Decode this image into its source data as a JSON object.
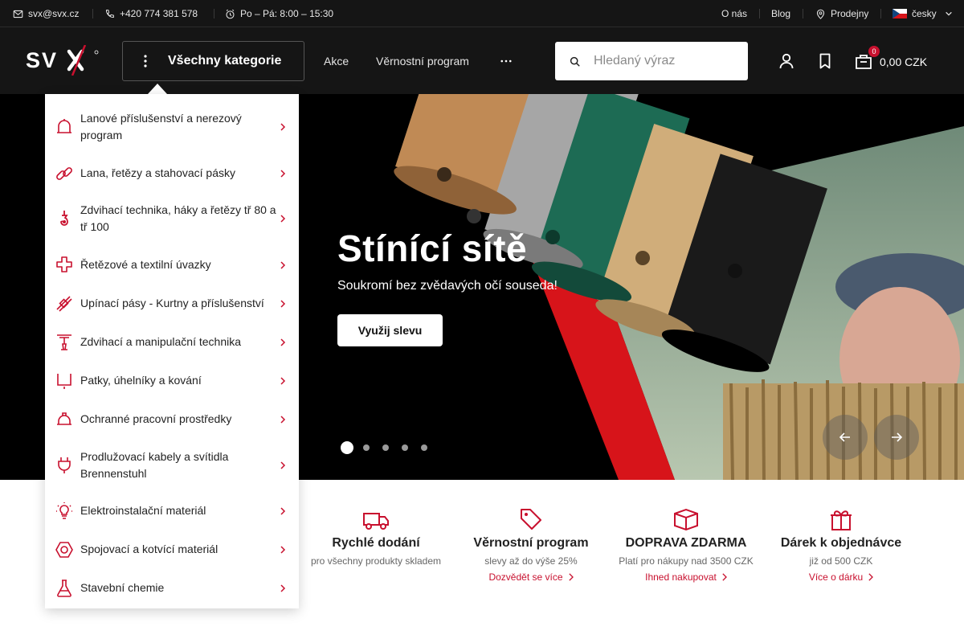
{
  "topbar": {
    "email": "svx@svx.cz",
    "phone": "+420 774 381 578",
    "hours": "Po – Pá: 8:00 – 15:30",
    "about": "O nás",
    "blog": "Blog",
    "stores": "Prodejny",
    "language": "česky"
  },
  "header": {
    "logo_text": "SVX",
    "all_categories": "Všechny kategorie",
    "nav": [
      "Akce",
      "Věrnostní program"
    ],
    "more_icon": "more-dots-icon",
    "search_placeholder": "Hledaný výraz",
    "cart_count": "0",
    "cart_total": "0,00 CZK"
  },
  "hero": {
    "title": "Stínící sítě",
    "subtitle": "Soukromí bez zvědavých očí souseda!",
    "button": "Využij slevu",
    "slides": 5,
    "active_slide": 1
  },
  "menu": {
    "items": [
      {
        "label": "Lanové příslušenství a nerezový program",
        "icon": "bell-icon"
      },
      {
        "label": "Lana, řetězy a stahovací pásky",
        "icon": "chain-link-icon"
      },
      {
        "label": "Zdvihací technika, háky a řetězy tř 80 a tř 100",
        "icon": "hook-icon"
      },
      {
        "label": "Řetězové a textilní úvazky",
        "icon": "sling-icon"
      },
      {
        "label": "Upínací pásy - Kurtny a příslušenství",
        "icon": "strap-icon"
      },
      {
        "label": "Zdvihací a manipulační technika",
        "icon": "hoist-icon"
      },
      {
        "label": "Patky, úhelníky a kování",
        "icon": "bracket-icon"
      },
      {
        "label": "Ochranné pracovní prostředky",
        "icon": "helmet-icon"
      },
      {
        "label": "Prodlužovací kabely a svítidla Brennenstuhl",
        "icon": "plug-icon"
      },
      {
        "label": "Elektroinstalační materiál",
        "icon": "bulb-icon"
      },
      {
        "label": "Spojovací a kotvící materiál",
        "icon": "nut-icon"
      },
      {
        "label": "Stavební chemie",
        "icon": "flask-icon"
      }
    ]
  },
  "features": [
    {
      "title": "Rychlé dodání",
      "desc": "pro všechny produkty skladem",
      "link": "",
      "icon": "truck-icon"
    },
    {
      "title": "Věrnostní program",
      "desc": "slevy až do výše 25%",
      "link": "Dozvědět se více",
      "icon": "tag-icon"
    },
    {
      "title": "DOPRAVA ZDARMA",
      "desc": "Platí pro nákupy nad 3500 CZK",
      "link": "Ihned nakupovat",
      "icon": "box-icon"
    },
    {
      "title": "Dárek k objednávce",
      "desc": "již od 500 CZK",
      "link": "Více o dárku",
      "icon": "gift-icon"
    }
  ],
  "colors": {
    "accent": "#c8102e",
    "dark": "#151515"
  }
}
